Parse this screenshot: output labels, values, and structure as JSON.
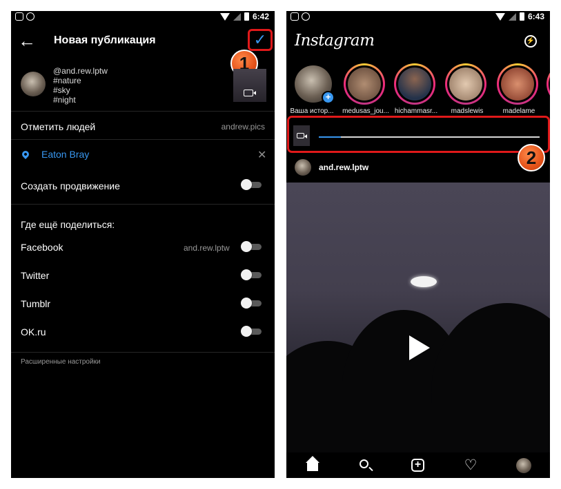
{
  "left_screen": {
    "status_time": "6:42",
    "header": {
      "back_icon": "arrow-left",
      "title": "Новая публикация",
      "confirm_icon": "check"
    },
    "annotation_1": "1",
    "post": {
      "caption_lines": [
        "@and.rew.lptw",
        "#nature",
        "#sky",
        "#night"
      ]
    },
    "tag_people": {
      "label": "Отметить людей",
      "value": "andrew.pics"
    },
    "location": {
      "label": "Eaton Bray",
      "icon": "location-pin",
      "close_icon": "x"
    },
    "promotion": {
      "label": "Создать продвижение",
      "enabled": false
    },
    "share_section": {
      "heading": "Где ещё поделиться:",
      "items": [
        {
          "label": "Facebook",
          "account": "and.rew.lptw",
          "enabled": false
        },
        {
          "label": "Twitter",
          "account": "",
          "enabled": false
        },
        {
          "label": "Tumblr",
          "account": "",
          "enabled": false
        },
        {
          "label": "OK.ru",
          "account": "",
          "enabled": false
        }
      ]
    },
    "advanced_settings": "Расширенные настройки"
  },
  "right_screen": {
    "status_time": "6:43",
    "app_logo": "Instagram",
    "messenger_icon": "messenger",
    "stories": [
      {
        "name": "Ваша истор...",
        "own": true
      },
      {
        "name": "medusas_jou..."
      },
      {
        "name": "hichammasr..."
      },
      {
        "name": "madslewis"
      },
      {
        "name": "madelame"
      }
    ],
    "annotation_2": "2",
    "upload_progress": 0.1,
    "post": {
      "username": "and.rew.lptw"
    },
    "bottom_nav": [
      "home",
      "search",
      "new-post",
      "activity",
      "profile"
    ]
  },
  "colors": {
    "accent": "#3897f0",
    "highlight": "#e0191a",
    "badge": "#e5531a"
  }
}
